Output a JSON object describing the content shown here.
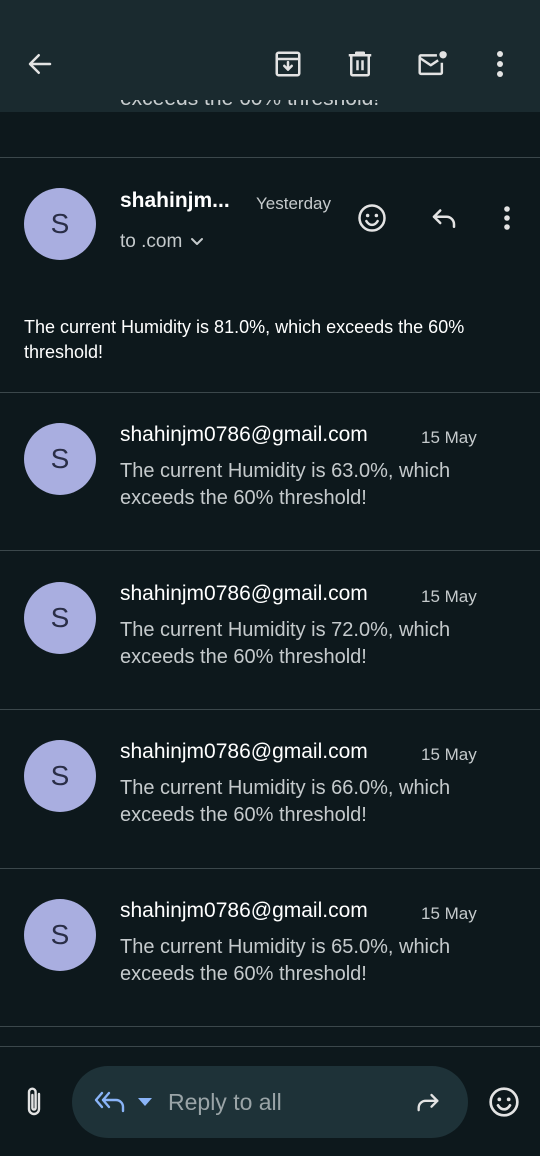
{
  "toolbar": {
    "back_icon": "arrow-left-icon",
    "archive_icon": "archive-icon",
    "delete_icon": "trash-icon",
    "mark_unread_icon": "mail-unread-icon",
    "more_icon": "more-vert-icon"
  },
  "open_message": {
    "avatar_letter": "S",
    "sender": "shahinjm...",
    "date": "Yesterday",
    "recipient": "to .com",
    "body": "The current Humidity is 81.0%, which exceeds the 60% threshold!"
  },
  "thread": [
    {
      "avatar_letter": "S",
      "sender": "shahinjm0786@gmail.com",
      "date": "15 May",
      "snippet": "The current Humidity is 63.0%, which exceeds the 60% threshold!"
    },
    {
      "avatar_letter": "S",
      "sender": "shahinjm0786@gmail.com",
      "date": "15 May",
      "snippet": "The current Humidity is 72.0%, which exceeds the 60% threshold!"
    },
    {
      "avatar_letter": "S",
      "sender": "shahinjm0786@gmail.com",
      "date": "15 May",
      "snippet": "The current Humidity is 66.0%, which exceeds the 60% threshold!"
    },
    {
      "avatar_letter": "S",
      "sender": "shahinjm0786@gmail.com",
      "date": "15 May",
      "snippet": "The current Humidity is 65.0%, which exceeds the 60% threshold!"
    }
  ],
  "composer": {
    "placeholder": "Reply to all"
  },
  "colors": {
    "background": "#0d181c",
    "toolbar": "#1a2a2f",
    "avatar": "#a9aee0",
    "reply_pill": "#1e3238",
    "accent_blue": "#8ab4f8"
  }
}
